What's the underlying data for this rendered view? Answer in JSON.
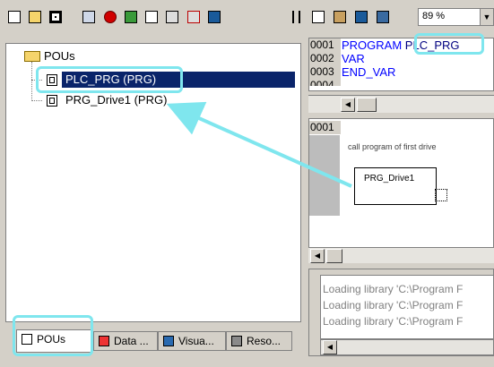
{
  "toolbar": {
    "icons": [
      "new-file-icon",
      "open-file-icon",
      "save-icon",
      "build-icon",
      "stop-icon",
      "login-icon",
      "insert-icon",
      "print-icon",
      "delete-icon",
      "find-icon",
      "cut-icon",
      "copy-icon",
      "paste-icon",
      "search-icon",
      "replace-icon"
    ],
    "zoom_value": "89 %",
    "zoom_arrow": "▼"
  },
  "tree": {
    "root_label": "POUs",
    "items": [
      {
        "label": "PLC_PRG (PRG)"
      },
      {
        "label": "PRG_Drive1 (PRG)"
      }
    ]
  },
  "tabs": [
    {
      "label": "POUs"
    },
    {
      "label": "Data ..."
    },
    {
      "label": "Visua..."
    },
    {
      "label": "Reso..."
    }
  ],
  "declaration": {
    "lines": [
      {
        "num": "0001",
        "keyword": "PROGRAM",
        "name": "PLC_PRG"
      },
      {
        "num": "0002",
        "keyword": "VAR",
        "name": ""
      },
      {
        "num": "0003",
        "keyword": "END_VAR",
        "name": ""
      },
      {
        "num": "0004",
        "keyword": "",
        "name": ""
      }
    ]
  },
  "cfc": {
    "line_num": "0001",
    "comment": "call program of first drive",
    "block_label": "PRG_Drive1"
  },
  "messages": [
    "Loading library 'C:\\Program F",
    "Loading library 'C:\\Program F",
    "Loading library 'C:\\Program F"
  ],
  "colors": {
    "highlight": "#7fe6ee",
    "selection": "#0a246a",
    "keyword": "#0000ff"
  }
}
